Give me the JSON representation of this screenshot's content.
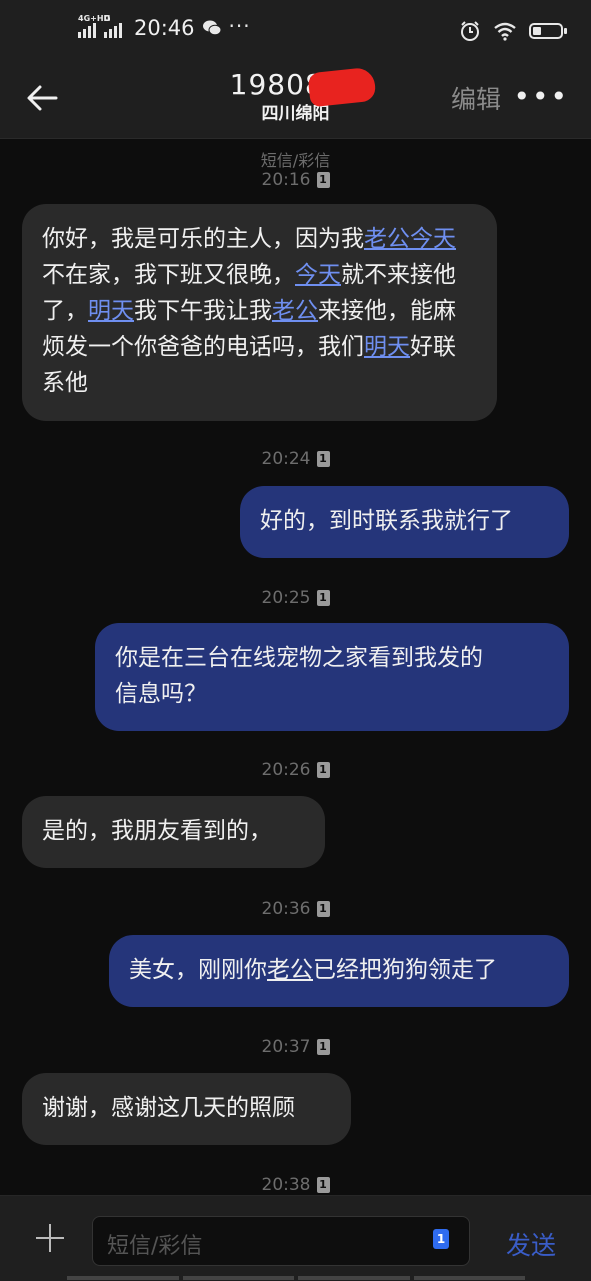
{
  "status_bar": {
    "signal1_label": "4G+HD",
    "signal2_label": "G",
    "time": "20:46",
    "more": "···"
  },
  "header": {
    "contact_number": "1980821",
    "contact_location": "四川绵阳",
    "edit_label": "编辑",
    "more_label": "•••"
  },
  "chat": {
    "channel_label": "短信/彩信",
    "sim_badge": "1",
    "messages": [
      {
        "direction": "incoming",
        "time": "20:16",
        "parts": [
          "你好，我是可乐的主人，因为我",
          "老公",
          "今天",
          "不在家，我下班又很晚，",
          "今天",
          "就不来接他了，",
          "明天",
          "我下午我让我",
          "老公",
          "来接他，能麻烦发一个你爸爸的电话吗，我们",
          "明天",
          "好联系他"
        ]
      },
      {
        "direction": "outgoing",
        "time": "20:24",
        "text": "好的，到时联系我就行了"
      },
      {
        "direction": "outgoing",
        "time": "20:25",
        "line1": "你是在三台在线宠物之家看到我发的",
        "line2": "信息吗？"
      },
      {
        "direction": "incoming",
        "time": "20:26",
        "text": "是的，我朋友看到的，"
      },
      {
        "direction": "outgoing",
        "time": "20:36",
        "parts": [
          "美女，刚刚你",
          "老公",
          "已经把狗狗领走了"
        ]
      },
      {
        "direction": "incoming",
        "time": "20:37",
        "text": "谢谢，感谢这几天的照顾"
      },
      {
        "direction": "system",
        "time": "20:38"
      }
    ]
  },
  "composer": {
    "placeholder": "短信/彩信",
    "sim_badge": "1",
    "send_label": "发送"
  },
  "colors": {
    "incoming_bubble": "#2a2a2a",
    "outgoing_bubble": "#25357a",
    "link": "#6f8ff0",
    "send": "#3a5dc8",
    "redaction": "#e8231f"
  }
}
